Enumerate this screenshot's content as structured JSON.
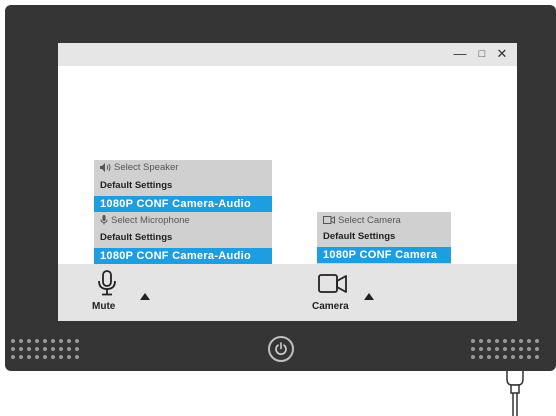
{
  "window_controls": {
    "minimize": "—",
    "maximize": "□",
    "close": "✕"
  },
  "speaker_panel": {
    "heading": "Select Speaker",
    "heading_icon": "speaker-icon",
    "options": [
      "Default Settings",
      "1080P CONF Camera-Audio"
    ],
    "selected": "1080P CONF Camera-Audio"
  },
  "microphone_panel": {
    "heading": "Select Microphone",
    "heading_icon": "microphone-icon",
    "options": [
      "Default Settings",
      "1080P CONF Camera-Audio"
    ],
    "selected": "1080P CONF Camera-Audio"
  },
  "camera_panel": {
    "heading": "Select Camera",
    "heading_icon": "camera-icon",
    "options": [
      "Default Settings",
      "1080P CONF Camera"
    ],
    "selected": "1080P CONF Camera"
  },
  "toolbar": {
    "mute_label": "Mute",
    "mute_icon": "microphone-icon",
    "camera_label": "Camera",
    "camera_icon": "video-camera-icon",
    "expand_icon": "caret-up-icon"
  },
  "monitor": {
    "power_icon": "power-icon"
  },
  "colors": {
    "accent": "#1e9ee0",
    "bezel": "#353535",
    "panel": "#d0d0d0",
    "titlebar": "#e6e6e6"
  }
}
